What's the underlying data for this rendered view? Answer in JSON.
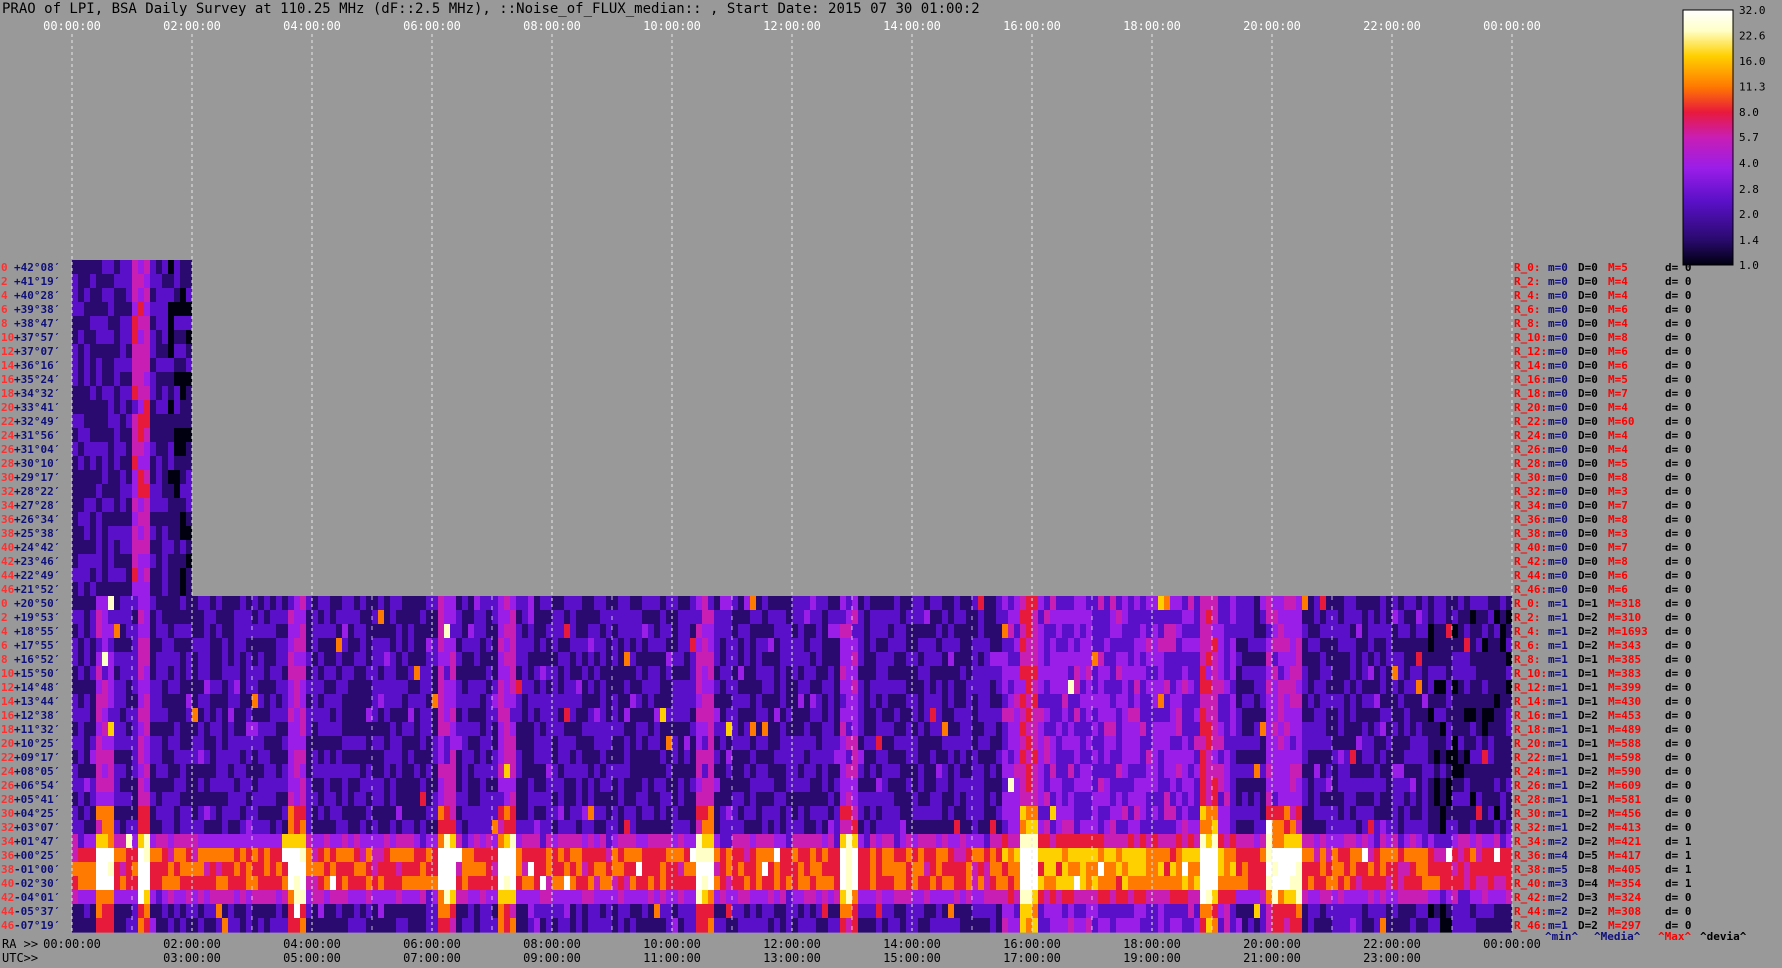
{
  "title": "PRAO of LPI, BSA Daily Survey at 110.25 MHz (dF::2.5 MHz), ::Noise_of_FLUX_median:: , Start Date: 2015 07 30 01:00:2",
  "colors": {
    "background": "#999999",
    "palette": [
      "#000010",
      "#2a0a6e",
      "#5a10c8",
      "#9a1ee8",
      "#c81eb4",
      "#e81a3c",
      "#ff7a00",
      "#ffd000",
      "#ffffc8",
      "#ffffff"
    ]
  },
  "labels": {
    "ra_prefix": "RA >>",
    "utc_prefix": "UTC>>",
    "stats_legend": [
      "^min^",
      "^Media^",
      "^Max^",
      "^devia^"
    ]
  },
  "chart_data": {
    "type": "heatmap",
    "x_top_ticks": [
      "00:00:00",
      "02:00:00",
      "04:00:00",
      "06:00:00",
      "08:00:00",
      "10:00:00",
      "12:00:00",
      "14:00:00",
      "16:00:00",
      "18:00:00",
      "20:00:00",
      "22:00:00",
      "00:00:00"
    ],
    "x_bottom_ra_ticks": [
      "00:00:00",
      "02:00:00",
      "04:00:00",
      "06:00:00",
      "08:00:00",
      "10:00:00",
      "12:00:00",
      "14:00:00",
      "16:00:00",
      "18:00:00",
      "20:00:00",
      "22:00:00",
      "00:00:00"
    ],
    "x_bottom_utc_ticks": [
      "03:00:00",
      "05:00:00",
      "07:00:00",
      "09:00:00",
      "11:00:00",
      "13:00:00",
      "15:00:00",
      "17:00:00",
      "19:00:00",
      "21:00:00",
      "23:00:00"
    ],
    "colorbar": {
      "ticks": [
        "32.0",
        "22.6",
        "16.0",
        "11.3",
        "8.0",
        "5.7",
        "4.0",
        "2.8",
        "2.0",
        "1.4",
        "1.0"
      ],
      "range": [
        1.0,
        32.0
      ],
      "scale": "log"
    },
    "upper_block": {
      "row_numbers": [
        "0",
        "2",
        "4",
        "6",
        "8",
        "10",
        "12",
        "14",
        "16",
        "18",
        "20",
        "22",
        "24",
        "26",
        "28",
        "30",
        "32",
        "34",
        "36",
        "38",
        "40",
        "42",
        "44",
        "46"
      ],
      "declinations": [
        "+42°08′",
        "+41°19′",
        "+40°28′",
        "+39°38′",
        "+38°47′",
        "+37°57′",
        "+37°07′",
        "+36°16′",
        "+35°24′",
        "+34°32′",
        "+33°41′",
        "+32°49′",
        "+31°56′",
        "+31°04′",
        "+30°10′",
        "+29°17′",
        "+28°22′",
        "+27°28′",
        "+26°34′",
        "+25°38′",
        "+24°42′",
        "+23°46′",
        "+22°49′",
        "+21°52′"
      ],
      "time_range": [
        "00:00:00",
        "02:00:00"
      ],
      "stats": [
        {
          "r": "R_0:",
          "min": "m=0",
          "med": "D=0",
          "max": "M=5",
          "dev": "d= 0"
        },
        {
          "r": "R_2:",
          "min": "m=0",
          "med": "D=0",
          "max": "M=4",
          "dev": "d= 0"
        },
        {
          "r": "R_4:",
          "min": "m=0",
          "med": "D=0",
          "max": "M=4",
          "dev": "d= 0"
        },
        {
          "r": "R_6:",
          "min": "m=0",
          "med": "D=0",
          "max": "M=6",
          "dev": "d= 0"
        },
        {
          "r": "R_8:",
          "min": "m=0",
          "med": "D=0",
          "max": "M=4",
          "dev": "d= 0"
        },
        {
          "r": "R_10:",
          "min": "m=0",
          "med": "D=0",
          "max": "M=8",
          "dev": "d= 0"
        },
        {
          "r": "R_12:",
          "min": "m=0",
          "med": "D=0",
          "max": "M=6",
          "dev": "d= 0"
        },
        {
          "r": "R_14:",
          "min": "m=0",
          "med": "D=0",
          "max": "M=6",
          "dev": "d= 0"
        },
        {
          "r": "R_16:",
          "min": "m=0",
          "med": "D=0",
          "max": "M=5",
          "dev": "d= 0"
        },
        {
          "r": "R_18:",
          "min": "m=0",
          "med": "D=0",
          "max": "M=7",
          "dev": "d= 0"
        },
        {
          "r": "R_20:",
          "min": "m=0",
          "med": "D=0",
          "max": "M=4",
          "dev": "d= 0"
        },
        {
          "r": "R_22:",
          "min": "m=0",
          "med": "D=0",
          "max": "M=60",
          "dev": "d= 0"
        },
        {
          "r": "R_24:",
          "min": "m=0",
          "med": "D=0",
          "max": "M=4",
          "dev": "d= 0"
        },
        {
          "r": "R_26:",
          "min": "m=0",
          "med": "D=0",
          "max": "M=4",
          "dev": "d= 0"
        },
        {
          "r": "R_28:",
          "min": "m=0",
          "med": "D=0",
          "max": "M=5",
          "dev": "d= 0"
        },
        {
          "r": "R_30:",
          "min": "m=0",
          "med": "D=0",
          "max": "M=8",
          "dev": "d= 0"
        },
        {
          "r": "R_32:",
          "min": "m=0",
          "med": "D=0",
          "max": "M=3",
          "dev": "d= 0"
        },
        {
          "r": "R_34:",
          "min": "m=0",
          "med": "D=0",
          "max": "M=7",
          "dev": "d= 0"
        },
        {
          "r": "R_36:",
          "min": "m=0",
          "med": "D=0",
          "max": "M=8",
          "dev": "d= 0"
        },
        {
          "r": "R_38:",
          "min": "m=0",
          "med": "D=0",
          "max": "M=3",
          "dev": "d= 0"
        },
        {
          "r": "R_40:",
          "min": "m=0",
          "med": "D=0",
          "max": "M=7",
          "dev": "d= 0"
        },
        {
          "r": "R_42:",
          "min": "m=0",
          "med": "D=0",
          "max": "M=8",
          "dev": "d= 0"
        },
        {
          "r": "R_44:",
          "min": "m=0",
          "med": "D=0",
          "max": "M=6",
          "dev": "d= 0"
        },
        {
          "r": "R_46:",
          "min": "m=0",
          "med": "D=0",
          "max": "M=6",
          "dev": "d= 0"
        }
      ]
    },
    "lower_block": {
      "row_numbers": [
        "0",
        "2",
        "4",
        "6",
        "8",
        "10",
        "12",
        "14",
        "16",
        "18",
        "20",
        "22",
        "24",
        "26",
        "28",
        "30",
        "32",
        "34",
        "36",
        "38",
        "40",
        "42",
        "44",
        "46"
      ],
      "declinations": [
        "+20°50′",
        "+19°53′",
        "+18°55′",
        "+17°55′",
        "+16°52′",
        "+15°50′",
        "+14°48′",
        "+13°44′",
        "+12°38′",
        "+11°32′",
        "+10°25′",
        "+09°17′",
        "+08°05′",
        "+06°54′",
        "+05°41′",
        "+04°25′",
        "+03°07′",
        "+01°47′",
        "+00°25′",
        "-01°00′",
        "-02°30′",
        "-04°01′",
        "-05°37′",
        "-07°19′"
      ],
      "time_range": [
        "02:00:00",
        "00:00:00"
      ],
      "stats": [
        {
          "r": "R_0:",
          "min": "m=1",
          "med": "D=1",
          "max": "M=318",
          "dev": "d= 0"
        },
        {
          "r": "R_2:",
          "min": "m=1",
          "med": "D=2",
          "max": "M=310",
          "dev": "d= 0"
        },
        {
          "r": "R_4:",
          "min": "m=1",
          "med": "D=2",
          "max": "M=1693",
          "dev": "d= 0"
        },
        {
          "r": "R_6:",
          "min": "m=1",
          "med": "D=2",
          "max": "M=343",
          "dev": "d= 0"
        },
        {
          "r": "R_8:",
          "min": "m=1",
          "med": "D=1",
          "max": "M=385",
          "dev": "d= 0"
        },
        {
          "r": "R_10:",
          "min": "m=1",
          "med": "D=1",
          "max": "M=383",
          "dev": "d= 0"
        },
        {
          "r": "R_12:",
          "min": "m=1",
          "med": "D=1",
          "max": "M=399",
          "dev": "d= 0"
        },
        {
          "r": "R_14:",
          "min": "m=1",
          "med": "D=1",
          "max": "M=430",
          "dev": "d= 0"
        },
        {
          "r": "R_16:",
          "min": "m=1",
          "med": "D=2",
          "max": "M=453",
          "dev": "d= 0"
        },
        {
          "r": "R_18:",
          "min": "m=1",
          "med": "D=1",
          "max": "M=489",
          "dev": "d= 0"
        },
        {
          "r": "R_20:",
          "min": "m=1",
          "med": "D=1",
          "max": "M=588",
          "dev": "d= 0"
        },
        {
          "r": "R_22:",
          "min": "m=1",
          "med": "D=1",
          "max": "M=598",
          "dev": "d= 0"
        },
        {
          "r": "R_24:",
          "min": "m=1",
          "med": "D=2",
          "max": "M=590",
          "dev": "d= 0"
        },
        {
          "r": "R_26:",
          "min": "m=1",
          "med": "D=2",
          "max": "M=609",
          "dev": "d= 0"
        },
        {
          "r": "R_28:",
          "min": "m=1",
          "med": "D=1",
          "max": "M=581",
          "dev": "d= 0"
        },
        {
          "r": "R_30:",
          "min": "m=1",
          "med": "D=2",
          "max": "M=456",
          "dev": "d= 0"
        },
        {
          "r": "R_32:",
          "min": "m=1",
          "med": "D=2",
          "max": "M=413",
          "dev": "d= 0"
        },
        {
          "r": "R_34:",
          "min": "m=2",
          "med": "D=2",
          "max": "M=421",
          "dev": "d= 1"
        },
        {
          "r": "R_36:",
          "min": "m=4",
          "med": "D=5",
          "max": "M=417",
          "dev": "d= 1"
        },
        {
          "r": "R_38:",
          "min": "m=5",
          "med": "D=8",
          "max": "M=405",
          "dev": "d= 1"
        },
        {
          "r": "R_40:",
          "min": "m=3",
          "med": "D=4",
          "max": "M=354",
          "dev": "d= 1"
        },
        {
          "r": "R_42:",
          "min": "m=2",
          "med": "D=3",
          "max": "M=324",
          "dev": "d= 0"
        },
        {
          "r": "R_44:",
          "min": "m=2",
          "med": "D=2",
          "max": "M=308",
          "dev": "d= 0"
        },
        {
          "r": "R_46:",
          "min": "m=1",
          "med": "D=2",
          "max": "M=297",
          "dev": "d= 0"
        }
      ]
    }
  }
}
